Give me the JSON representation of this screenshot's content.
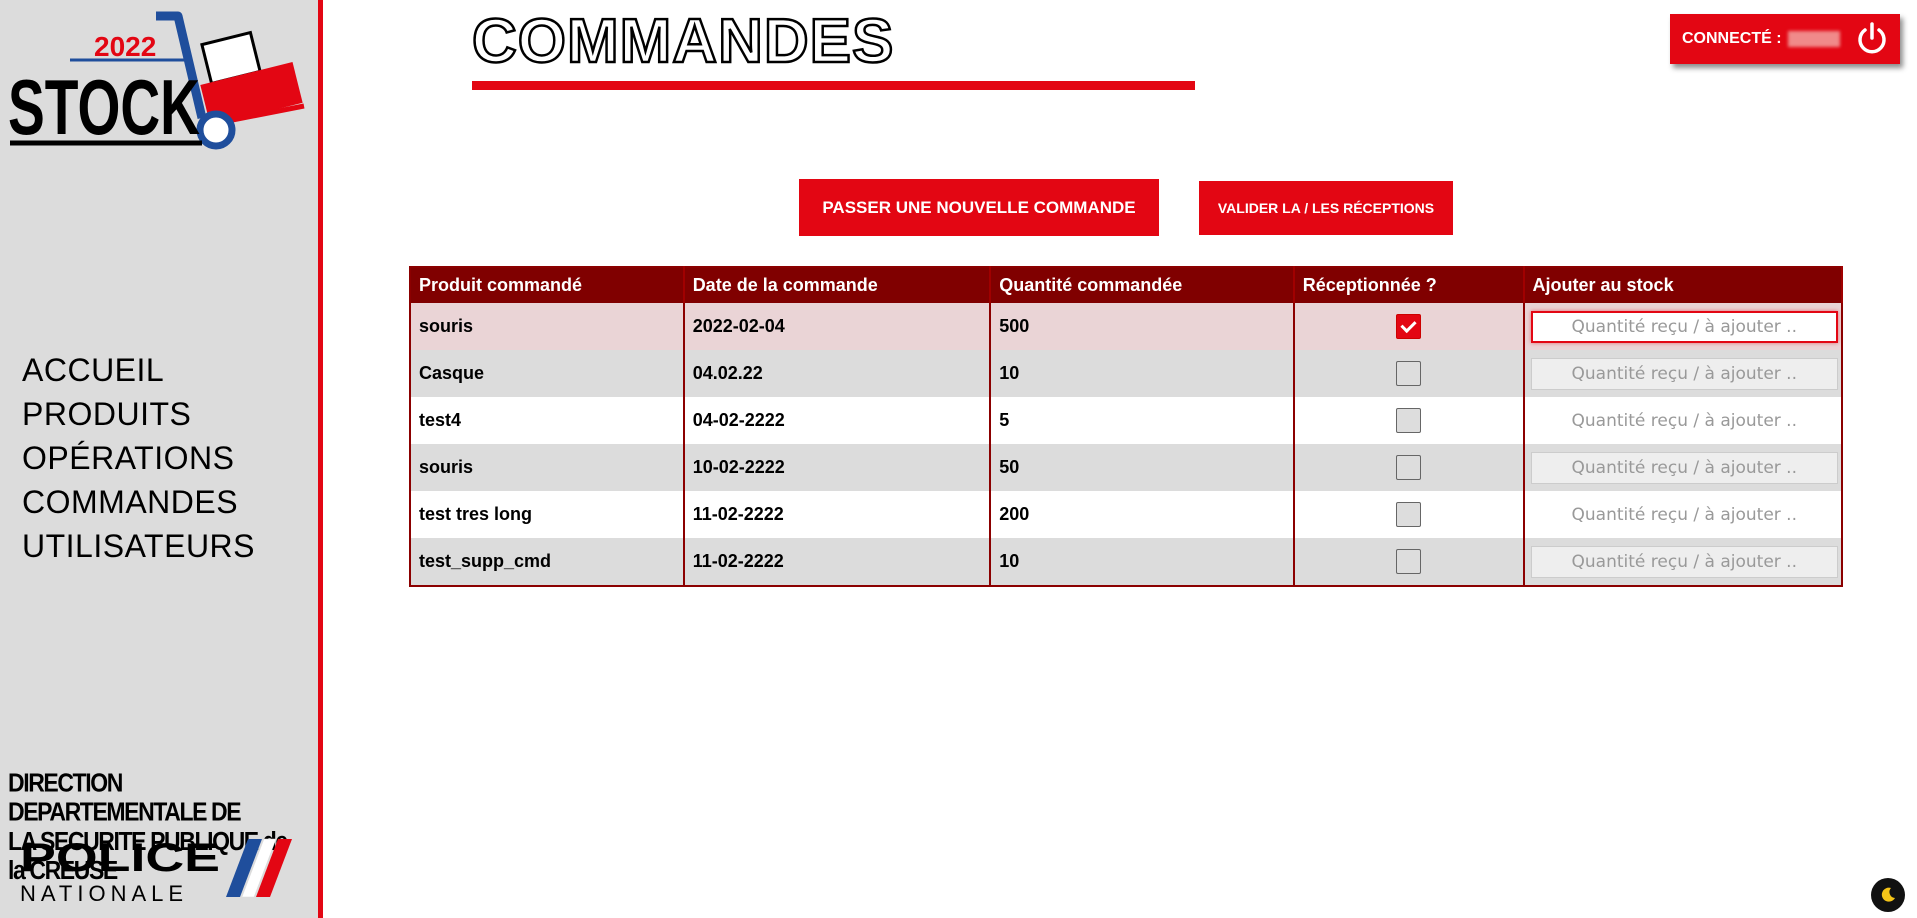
{
  "sidebar": {
    "logo_year": "2022",
    "logo_text": "STOCK",
    "nav": [
      "ACCUEIL",
      "PRODUITS",
      "OPÉRATIONS",
      "COMMANDES",
      "UTILISATEURS"
    ],
    "org_line1": "DIRECTION DEPARTEMENTALE DE",
    "org_line2": "LA SECURITE PUBLIQUE de la CREUSE",
    "police_line1": "POLICE",
    "police_line2": "NATIONALE"
  },
  "header": {
    "title": "COMMANDES",
    "connected_label": "CONNECTÉ :",
    "power_icon": "power-icon"
  },
  "actions": {
    "new_order": "PASSER UNE NOUVELLE COMMANDE",
    "validate": "VALIDER LA / LES RÉCEPTIONS"
  },
  "table": {
    "headers": [
      "Produit commandé",
      "Date de la commande",
      "Quantité commandée",
      "Réceptionnée ?",
      "Ajouter au stock"
    ],
    "placeholder": "Quantité reçu / à ajouter ..",
    "rows": [
      {
        "product": "souris",
        "date": "2022-02-04",
        "qty": "500",
        "received": true
      },
      {
        "product": "Casque",
        "date": "04.02.22",
        "qty": "10",
        "received": false
      },
      {
        "product": "test4",
        "date": "04-02-2222",
        "qty": "5",
        "received": false
      },
      {
        "product": "souris",
        "date": "10-02-2222",
        "qty": "50",
        "received": false
      },
      {
        "product": "test tres long",
        "date": "11-02-2222",
        "qty": "200",
        "received": false
      },
      {
        "product": "test_supp_cmd",
        "date": "11-02-2222",
        "qty": "10",
        "received": false
      }
    ]
  },
  "colors": {
    "accent": "#e30613",
    "table_header": "#800000",
    "sidebar_bg": "#dcdcdc",
    "logo_blue": "#1f4e9c"
  },
  "dark_mode_icon": "moon-icon"
}
